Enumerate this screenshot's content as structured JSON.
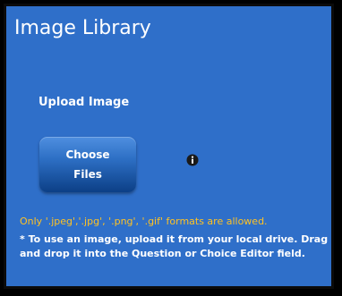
{
  "panel": {
    "title": "Image Library",
    "upload_label": "Upload Image",
    "choose_button_label": "Choose Files",
    "info_icon": "info-icon",
    "formats_note": "Only '.jpeg','.jpg', '.png', '.gif' formats are allowed.",
    "instructions": "* To use an image, upload it from your local drive. Drag and drop it into the Question or Choice Editor field."
  },
  "colors": {
    "panel_bg": "#2f6fc9",
    "button_top": "#4f8fe0",
    "button_bottom": "#0c3f86",
    "formats_text": "#ffc223",
    "text": "#ffffff"
  }
}
